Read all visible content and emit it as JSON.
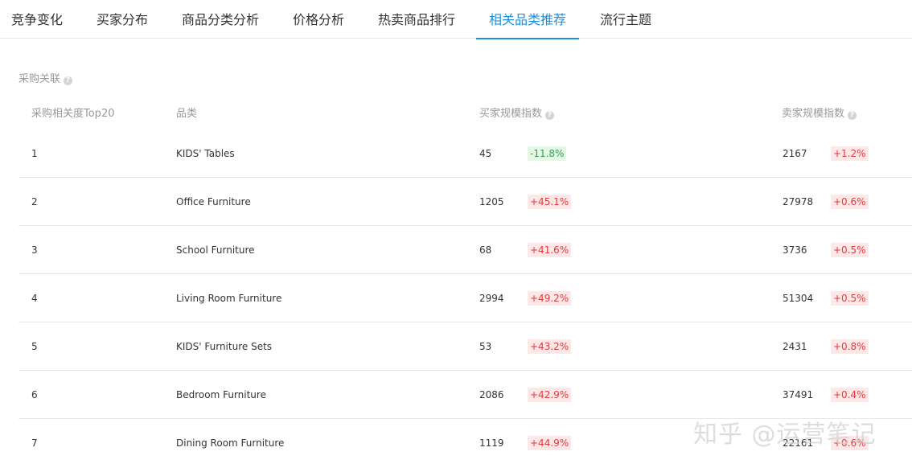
{
  "tabs": [
    {
      "label": "竞争变化",
      "active": false
    },
    {
      "label": "买家分布",
      "active": false
    },
    {
      "label": "商品分类分析",
      "active": false
    },
    {
      "label": "价格分析",
      "active": false
    },
    {
      "label": "热卖商品排行",
      "active": false
    },
    {
      "label": "相关品类推荐",
      "active": true
    },
    {
      "label": "流行主题",
      "active": false
    }
  ],
  "section": {
    "title": "采购关联",
    "help_glyph": "?"
  },
  "table": {
    "headers": {
      "rank": "采购相关度Top20",
      "category": "品类",
      "buyer_index": "买家规模指数",
      "seller_index": "卖家规模指数"
    },
    "rows": [
      {
        "rank": "1",
        "category": "KIDS' Tables",
        "buyer_index": "45",
        "buyer_change": "-11.8%",
        "buyer_trend": "down",
        "seller_index": "2167",
        "seller_change": "+1.2%",
        "seller_trend": "up"
      },
      {
        "rank": "2",
        "category": "Office Furniture",
        "buyer_index": "1205",
        "buyer_change": "+45.1%",
        "buyer_trend": "up",
        "seller_index": "27978",
        "seller_change": "+0.6%",
        "seller_trend": "up"
      },
      {
        "rank": "3",
        "category": "School Furniture",
        "buyer_index": "68",
        "buyer_change": "+41.6%",
        "buyer_trend": "up",
        "seller_index": "3736",
        "seller_change": "+0.5%",
        "seller_trend": "up"
      },
      {
        "rank": "4",
        "category": "Living Room Furniture",
        "buyer_index": "2994",
        "buyer_change": "+49.2%",
        "buyer_trend": "up",
        "seller_index": "51304",
        "seller_change": "+0.5%",
        "seller_trend": "up"
      },
      {
        "rank": "5",
        "category": "KIDS' Furniture Sets",
        "buyer_index": "53",
        "buyer_change": "+43.2%",
        "buyer_trend": "up",
        "seller_index": "2431",
        "seller_change": "+0.8%",
        "seller_trend": "up"
      },
      {
        "rank": "6",
        "category": "Bedroom Furniture",
        "buyer_index": "2086",
        "buyer_change": "+42.9%",
        "buyer_trend": "up",
        "seller_index": "37491",
        "seller_change": "+0.4%",
        "seller_trend": "up"
      },
      {
        "rank": "7",
        "category": "Dining Room Furniture",
        "buyer_index": "1119",
        "buyer_change": "+44.9%",
        "buyer_trend": "up",
        "seller_index": "22161",
        "seller_change": "+0.6%",
        "seller_trend": "up"
      }
    ]
  },
  "watermark": "知乎 @运营笔记",
  "colors": {
    "accent": "#1b8fd8",
    "up_text": "#e0393e",
    "up_bg": "#fde8e8",
    "down_text": "#2fa44f",
    "down_bg": "#e6f7e6"
  }
}
